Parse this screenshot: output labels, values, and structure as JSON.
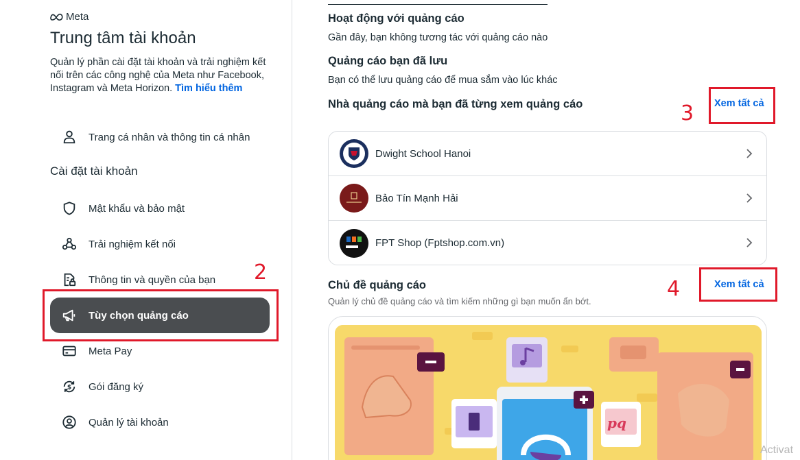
{
  "sidebar": {
    "brand": "Meta",
    "title": "Trung tâm tài khoản",
    "description": "Quản lý phần cài đặt tài khoản và trải nghiệm kết nối trên các công nghệ của Meta như Facebook, Instagram và Meta Horizon.",
    "learn_more": "Tìm hiểu thêm",
    "profile_item": "Trang cá nhân và thông tin cá nhân",
    "section_label": "Cài đặt tài khoản",
    "items": [
      {
        "label": "Mật khẩu và bảo mật",
        "icon": "shield-icon"
      },
      {
        "label": "Trải nghiệm kết nối",
        "icon": "connected-icon"
      },
      {
        "label": "Thông tin và quyền của bạn",
        "icon": "info-permissions-icon"
      },
      {
        "label": "Tùy chọn quảng cáo",
        "icon": "megaphone-icon",
        "active": true
      },
      {
        "label": "Meta Pay",
        "icon": "card-icon"
      },
      {
        "label": "Gói đăng ký",
        "icon": "subscription-icon"
      },
      {
        "label": "Quản lý tài khoản",
        "icon": "account-icon"
      }
    ]
  },
  "main": {
    "ad_activity": {
      "title": "Hoạt động với quảng cáo",
      "subtitle": "Gần đây, bạn không tương tác với quảng cáo nào"
    },
    "saved_ads": {
      "title": "Quảng cáo bạn đã lưu",
      "subtitle": "Bạn có thể lưu quảng cáo để mua sắm vào lúc khác"
    },
    "advertisers": {
      "title": "Nhà quảng cáo mà bạn đã từng xem quảng cáo",
      "see_all": "Xem tất cả",
      "list": [
        {
          "name": "Dwight School Hanoi",
          "logo_color": "#1b2f5e"
        },
        {
          "name": "Bảo Tín Mạnh Hải",
          "logo_color": "#7a1a1a"
        },
        {
          "name": "FPT Shop (Fptshop.com.vn)",
          "logo_color": "#111111"
        }
      ]
    },
    "ad_topics": {
      "title": "Chủ đề quảng cáo",
      "subtitle": "Quản lý chủ đề quảng cáo và tìm kiếm những gì bạn muốn ẩn bớt.",
      "see_all": "Xem tất cả"
    }
  },
  "annotations": {
    "n2": "2",
    "n3": "3",
    "n4": "4",
    "color": "#e0192a"
  },
  "watermark": "Activat",
  "colors": {
    "accent": "#0064e0",
    "active_bg": "#4a4d50",
    "illustration_bg": "#f7d96a"
  }
}
